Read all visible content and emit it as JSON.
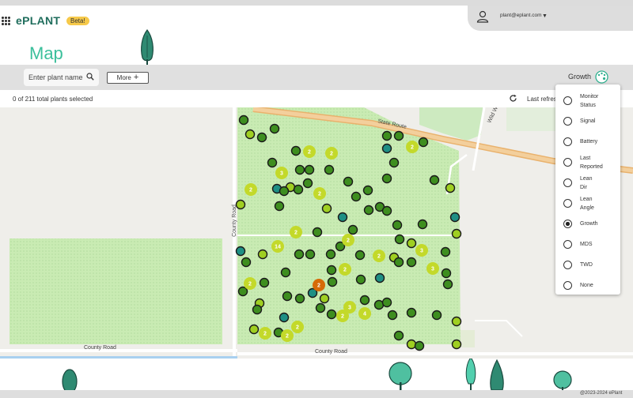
{
  "app": {
    "logo": "ePLANT",
    "badge": "Beta!"
  },
  "user": {
    "email": "plant@eplant.com"
  },
  "page": {
    "title": "Map"
  },
  "toolbar": {
    "search_placeholder": "Enter plant name",
    "more_label": "More",
    "color_by_label": "Growth"
  },
  "status": {
    "selected_text": "0 of 211 total plants selected",
    "last_refresh_text": "Last refresh"
  },
  "color_menu": {
    "options": [
      {
        "line1": "Monitor",
        "line2": "Status",
        "checked": false
      },
      {
        "line1": "Signal",
        "line2": "",
        "checked": false
      },
      {
        "line1": "Battery",
        "line2": "",
        "checked": false
      },
      {
        "line1": "Last",
        "line2": "Reported",
        "checked": false
      },
      {
        "line1": "Lean",
        "line2": "Dir",
        "checked": false
      },
      {
        "line1": "Lean",
        "line2": "Angle",
        "checked": false
      },
      {
        "line1": "Growth",
        "line2": "",
        "checked": true
      },
      {
        "line1": "MDS",
        "line2": "",
        "checked": false
      },
      {
        "line1": "TWD",
        "line2": "",
        "checked": false
      },
      {
        "line1": "None",
        "line2": "",
        "checked": false
      }
    ]
  },
  "map": {
    "roads": {
      "state_route": "State Route",
      "county_road_h1": "County Road",
      "county_road_h2": "County Road",
      "county_road_v": "County Road",
      "wild_way": "Wild W"
    },
    "colors": {
      "dark_green": "#3e8e1f",
      "lime": "#9fcf21",
      "yellow_green": "#c3d92a",
      "teal": "#1e8f84",
      "orange": "#d66a08"
    },
    "clusters": [
      {
        "count": "2",
        "color": "yellow_green"
      },
      {
        "count": "2",
        "color": "yellow_green"
      },
      {
        "count": "2",
        "color": "yellow_green"
      },
      {
        "count": "3",
        "color": "yellow_green"
      },
      {
        "count": "2",
        "color": "yellow_green"
      },
      {
        "count": "2",
        "color": "yellow_green"
      },
      {
        "count": "14",
        "color": "yellow_green"
      },
      {
        "count": "2",
        "color": "yellow_green"
      },
      {
        "count": "2",
        "color": "yellow_green"
      },
      {
        "count": "2",
        "color": "yellow_green"
      },
      {
        "count": "3",
        "color": "yellow_green"
      },
      {
        "count": "2",
        "color": "yellow_green"
      },
      {
        "count": "3",
        "color": "yellow_green"
      },
      {
        "count": "2",
        "color": "yellow_green"
      },
      {
        "count": "2",
        "color": "orange"
      },
      {
        "count": "3",
        "color": "yellow_green"
      },
      {
        "count": "2",
        "color": "yellow_green"
      },
      {
        "count": "4",
        "color": "yellow_green"
      },
      {
        "count": "2",
        "color": "yellow_green"
      },
      {
        "count": "2",
        "color": "yellow_green"
      },
      {
        "count": "2",
        "color": "yellow_green"
      }
    ]
  },
  "footer": {
    "copyright": "@2023-2024 ePlant"
  }
}
